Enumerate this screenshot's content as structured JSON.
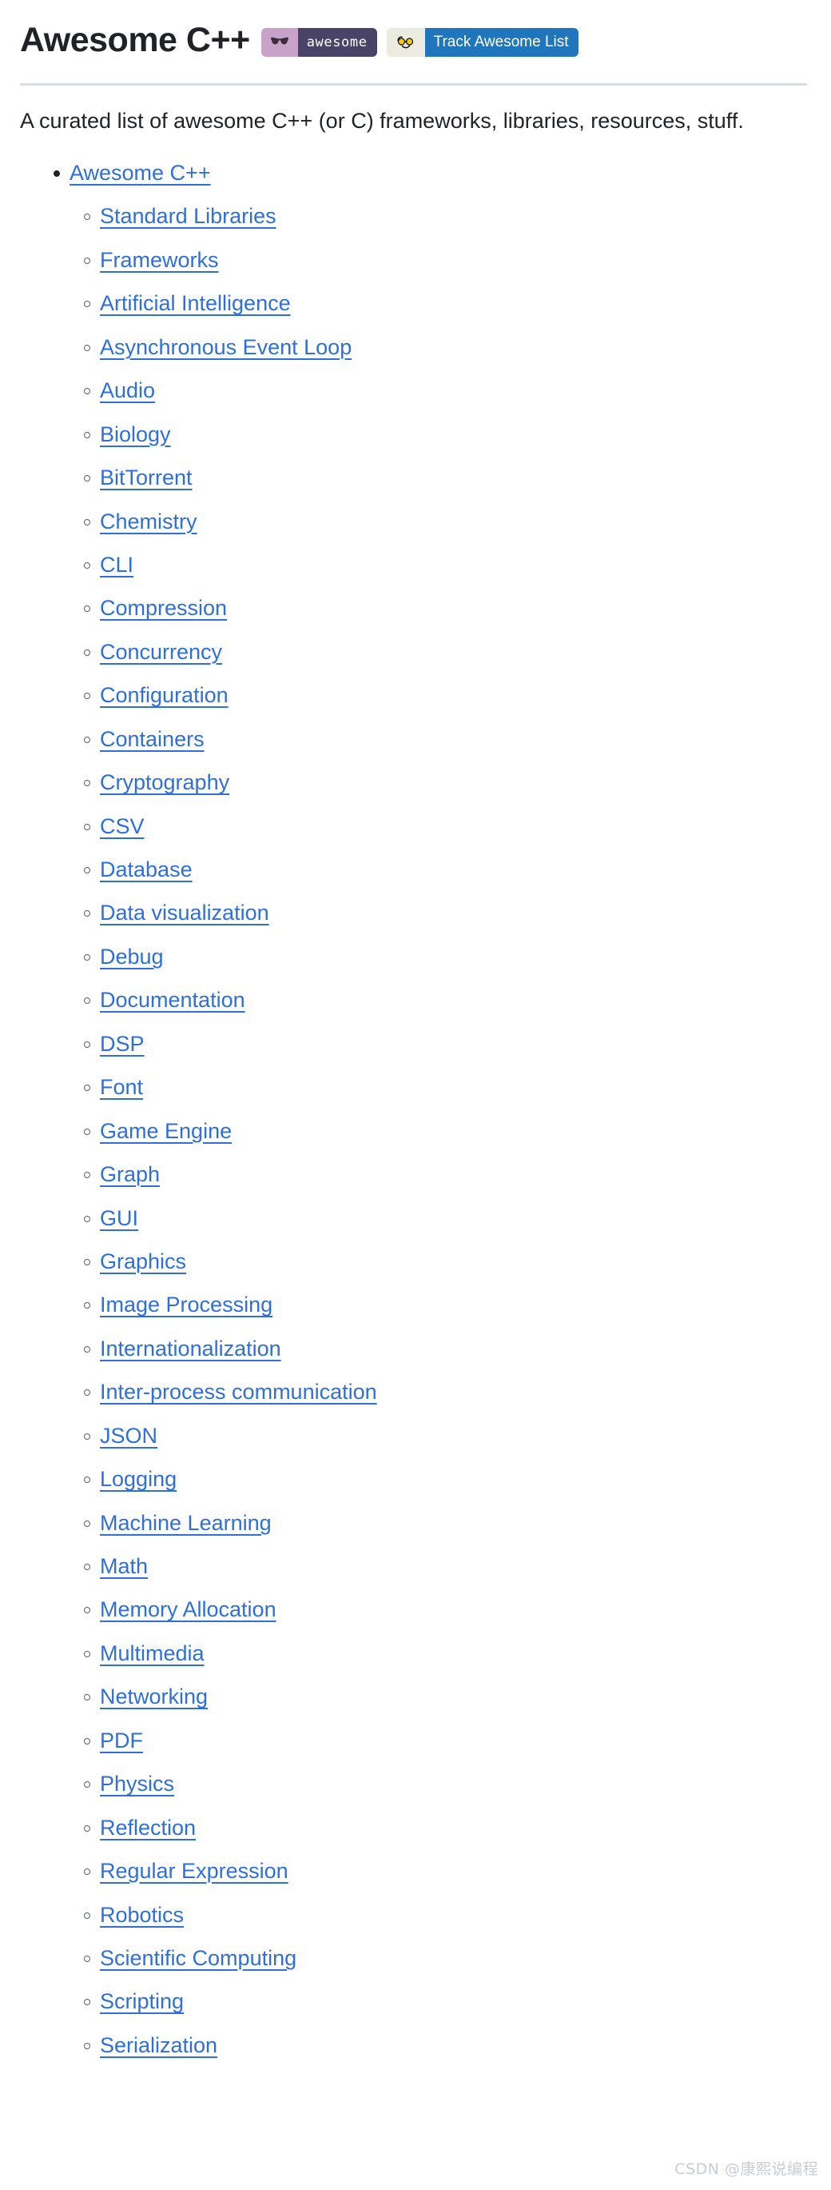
{
  "header": {
    "title": "Awesome C++",
    "badges": [
      {
        "name": "awesome-badge",
        "icon": "sunglasses-icon",
        "label": "awesome",
        "left_color": "#c8a2c8",
        "right_color": "#494368"
      },
      {
        "name": "track-awesome-list-badge",
        "icon": "eyes-glasses-icon",
        "label": "Track Awesome List",
        "left_color": "#ebebe2",
        "right_color": "#2076bc"
      }
    ]
  },
  "intro": {
    "text": "A curated list of awesome C++ (or C) frameworks, libraries, resources, stuff."
  },
  "toc": {
    "root": {
      "label": "Awesome C++"
    },
    "items": [
      {
        "label": "Standard Libraries"
      },
      {
        "label": "Frameworks"
      },
      {
        "label": "Artificial Intelligence"
      },
      {
        "label": "Asynchronous Event Loop"
      },
      {
        "label": "Audio"
      },
      {
        "label": "Biology"
      },
      {
        "label": "BitTorrent"
      },
      {
        "label": "Chemistry"
      },
      {
        "label": "CLI"
      },
      {
        "label": "Compression"
      },
      {
        "label": "Concurrency"
      },
      {
        "label": "Configuration"
      },
      {
        "label": "Containers"
      },
      {
        "label": "Cryptography"
      },
      {
        "label": "CSV"
      },
      {
        "label": "Database"
      },
      {
        "label": "Data visualization"
      },
      {
        "label": "Debug"
      },
      {
        "label": "Documentation"
      },
      {
        "label": "DSP"
      },
      {
        "label": "Font"
      },
      {
        "label": "Game Engine"
      },
      {
        "label": "Graph"
      },
      {
        "label": "GUI"
      },
      {
        "label": "Graphics"
      },
      {
        "label": "Image Processing"
      },
      {
        "label": "Internationalization"
      },
      {
        "label": "Inter-process communication"
      },
      {
        "label": "JSON"
      },
      {
        "label": "Logging"
      },
      {
        "label": "Machine Learning"
      },
      {
        "label": "Math"
      },
      {
        "label": "Memory Allocation"
      },
      {
        "label": "Multimedia"
      },
      {
        "label": "Networking"
      },
      {
        "label": "PDF"
      },
      {
        "label": "Physics"
      },
      {
        "label": "Reflection"
      },
      {
        "label": "Regular Expression"
      },
      {
        "label": "Robotics"
      },
      {
        "label": "Scientific Computing"
      },
      {
        "label": "Scripting"
      },
      {
        "label": "Serialization"
      }
    ]
  },
  "watermark": {
    "text": "CSDN @康熙说编程"
  },
  "colors": {
    "link": "#2f6fdd",
    "text": "#1f2328",
    "divider": "#d8dee4",
    "watermark": "#c9ccd1"
  }
}
